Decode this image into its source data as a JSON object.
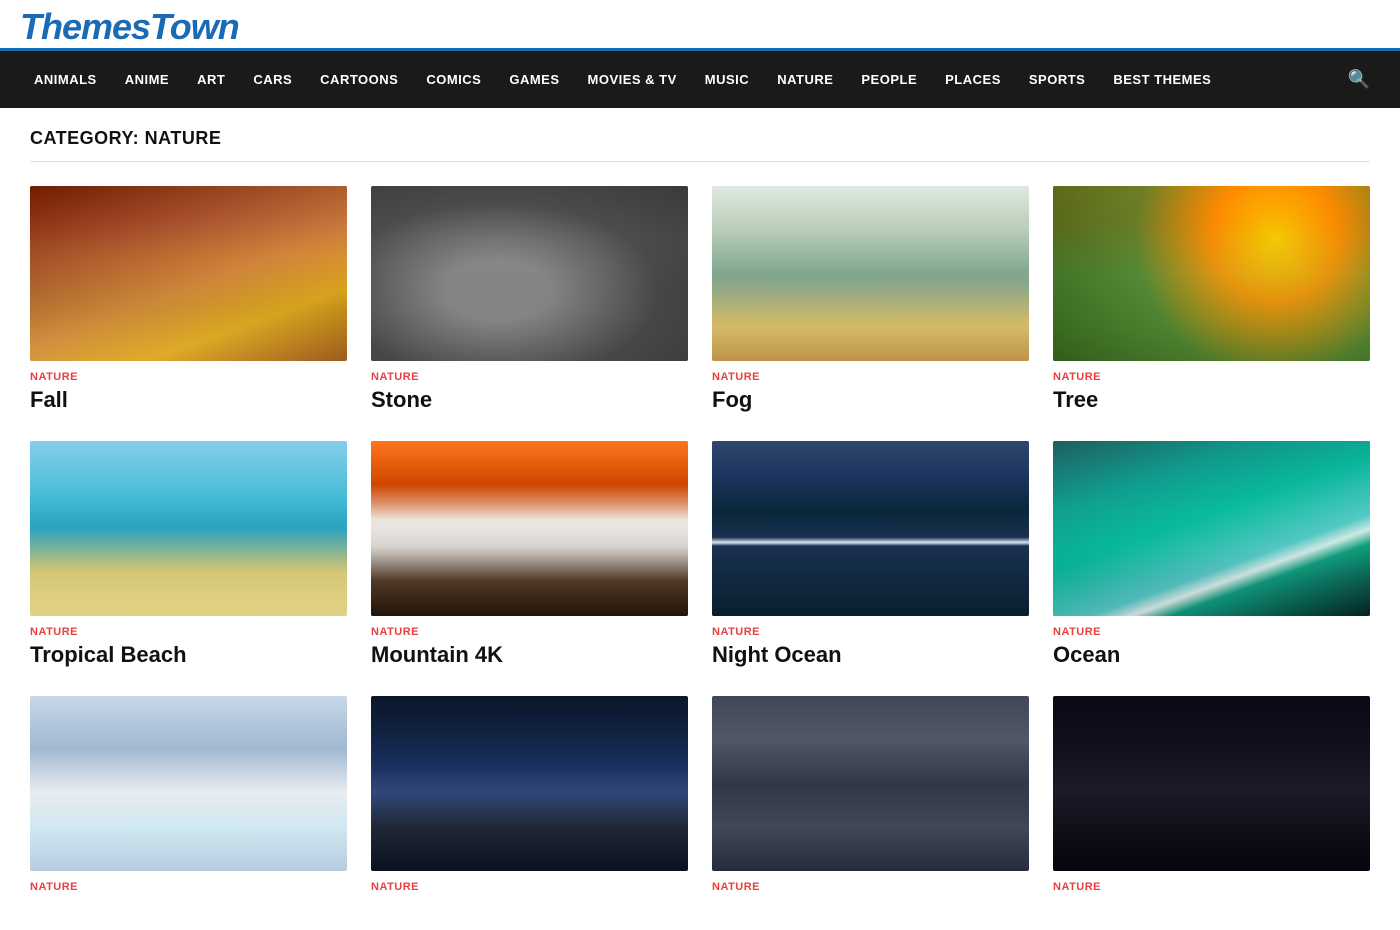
{
  "logo": {
    "text": "ThemesTown"
  },
  "nav": {
    "items": [
      {
        "label": "ANIMALS",
        "href": "#"
      },
      {
        "label": "ANIME",
        "href": "#"
      },
      {
        "label": "ART",
        "href": "#"
      },
      {
        "label": "CARS",
        "href": "#"
      },
      {
        "label": "CARTOONS",
        "href": "#"
      },
      {
        "label": "COMICS",
        "href": "#"
      },
      {
        "label": "GAMES",
        "href": "#"
      },
      {
        "label": "MOVIES & TV",
        "href": "#"
      },
      {
        "label": "MUSIC",
        "href": "#"
      },
      {
        "label": "NATURE",
        "href": "#",
        "active": true
      },
      {
        "label": "PEOPLE",
        "href": "#"
      },
      {
        "label": "PLACES",
        "href": "#"
      },
      {
        "label": "SPORTS",
        "href": "#"
      },
      {
        "label": "BEST THEMES",
        "href": "#"
      }
    ]
  },
  "page": {
    "category_label": "CATEGORY: NATURE"
  },
  "cards": [
    {
      "category": "NATURE",
      "title": "Fall",
      "img_class": "img-fall"
    },
    {
      "category": "NATURE",
      "title": "Stone",
      "img_class": "img-stone"
    },
    {
      "category": "NATURE",
      "title": "Fog",
      "img_class": "img-fog"
    },
    {
      "category": "NATURE",
      "title": "Tree",
      "img_class": "img-tree"
    },
    {
      "category": "NATURE",
      "title": "Tropical Beach",
      "img_class": "img-beach"
    },
    {
      "category": "NATURE",
      "title": "Mountain 4K",
      "img_class": "img-mountain"
    },
    {
      "category": "NATURE",
      "title": "Night Ocean",
      "img_class": "img-night-ocean"
    },
    {
      "category": "NATURE",
      "title": "Ocean",
      "img_class": "img-ocean-wave"
    },
    {
      "category": "NATURE",
      "title": "",
      "img_class": "img-snow-trees"
    },
    {
      "category": "NATURE",
      "title": "",
      "img_class": "img-night-mountain"
    },
    {
      "category": "NATURE",
      "title": "",
      "img_class": "img-water-drops"
    },
    {
      "category": "NATURE",
      "title": "",
      "img_class": "img-space"
    }
  ]
}
